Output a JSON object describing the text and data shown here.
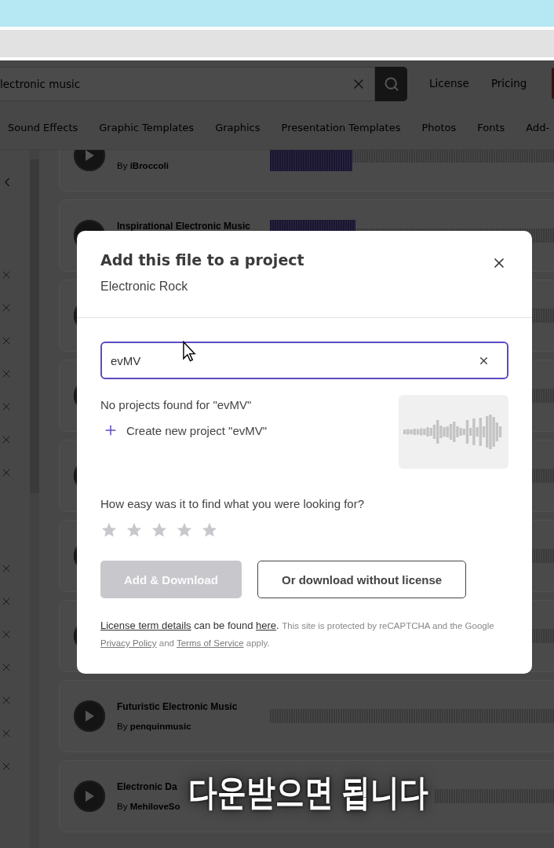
{
  "search": {
    "value": "lectronic music"
  },
  "nav_links": [
    "License",
    "Pricing"
  ],
  "categories": [
    "Sound Effects",
    "Graphic Templates",
    "Graphics",
    "Presentation Templates",
    "Photos",
    "Fonts",
    "Add-"
  ],
  "tracks_above": [
    {
      "author": "By **iBroccoli**",
      "level": 0.29
    },
    {
      "title": "Inspirational Electronic Music",
      "level": 0.3
    }
  ],
  "tracks_below": [
    {
      "title": "Futuristic Electronic Music",
      "author": "By **penquinmusic**"
    },
    {
      "title": "Electronic Da",
      "author": "By **MehiloveSo**"
    }
  ],
  "modal": {
    "title": "Add this file to a project",
    "file_name": "Electronic Rock",
    "search": {
      "value": "evMV"
    },
    "empty_message": "No projects found for \"evMV\"",
    "create_label": "Create new project \"evMV\"",
    "question": "How easy was it to find what you were looking for?",
    "stars": 0,
    "buttons": [
      {
        "label": "Add & Download",
        "disabled": true
      },
      {
        "label": "Or download without license",
        "disabled": false
      }
    ],
    "footer": [
      {
        "kind": "link",
        "text": "License term details"
      },
      {
        "kind": "text",
        "text": " can be found "
      },
      {
        "kind": "link",
        "text": "here"
      },
      {
        "kind": "text",
        "text": ". "
      },
      {
        "kind": "note",
        "text": "This site is protected by reCAPTCHA and the Google "
      },
      {
        "kind": "note-link",
        "text": "Privacy Policy"
      },
      {
        "kind": "note",
        "text": " and "
      },
      {
        "kind": "note-link",
        "text": "Terms of Service"
      },
      {
        "kind": "note",
        "text": " apply."
      }
    ]
  },
  "caption": "다운받으면 됩니다"
}
